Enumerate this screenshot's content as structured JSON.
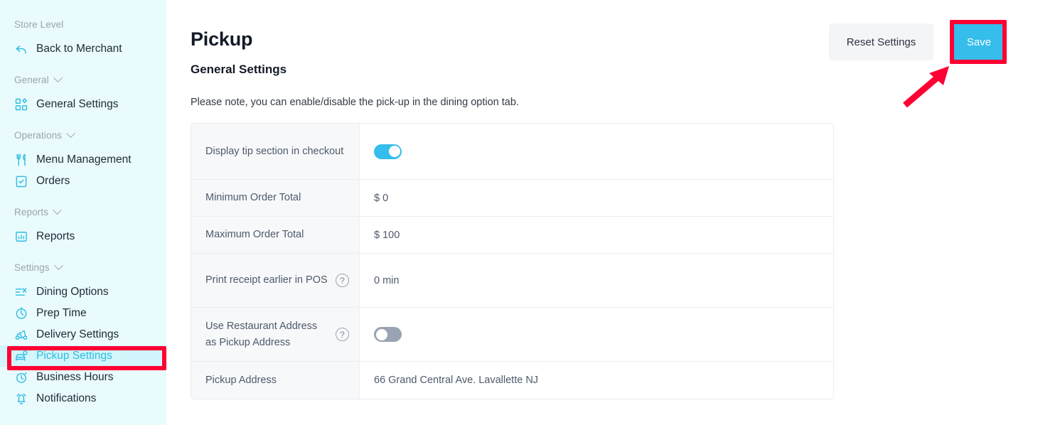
{
  "sidebar": {
    "groups": [
      {
        "label": "Store Level",
        "collapsible": false,
        "items": [
          {
            "label": "Back to Merchant",
            "icon": "back-arrow-icon",
            "active": false
          }
        ]
      },
      {
        "label": "General",
        "collapsible": true,
        "items": [
          {
            "label": "General Settings",
            "icon": "grid-blocks-icon",
            "active": false
          }
        ]
      },
      {
        "label": "Operations",
        "collapsible": true,
        "items": [
          {
            "label": "Menu Management",
            "icon": "fork-spoon-icon",
            "active": false
          },
          {
            "label": "Orders",
            "icon": "clipboard-check-icon",
            "active": false
          }
        ]
      },
      {
        "label": "Reports",
        "collapsible": true,
        "items": [
          {
            "label": "Reports",
            "icon": "bar-chart-icon",
            "active": false
          }
        ]
      },
      {
        "label": "Settings",
        "collapsible": true,
        "items": [
          {
            "label": "Dining Options",
            "icon": "sliders-icon",
            "active": false
          },
          {
            "label": "Prep Time",
            "icon": "clock-icon",
            "active": false
          },
          {
            "label": "Delivery Settings",
            "icon": "scooter-icon",
            "active": false
          },
          {
            "label": "Pickup Settings",
            "icon": "car-pickup-icon",
            "active": true
          },
          {
            "label": "Business Hours",
            "icon": "stopwatch-icon",
            "active": false
          },
          {
            "label": "Notifications",
            "icon": "bell-icon",
            "active": false
          }
        ]
      }
    ]
  },
  "header": {
    "page_title": "Pickup",
    "section_title": "General Settings",
    "note": "Please note, you can enable/disable the pick-up in the dining option tab.",
    "reset_label": "Reset Settings",
    "save_label": "Save"
  },
  "settings_rows": [
    {
      "label": "Display tip section in checkout",
      "has_help": false,
      "control": "toggle",
      "value": "on",
      "height": "h79"
    },
    {
      "label": "Minimum Order Total",
      "has_help": false,
      "control": "text",
      "value": "$ 0",
      "height": "h52"
    },
    {
      "label": "Maximum Order Total",
      "has_help": false,
      "control": "text",
      "value": "$ 100",
      "height": "h52"
    },
    {
      "label": "Print receipt earlier in POS",
      "has_help": true,
      "help_glyph": "?",
      "control": "text",
      "value": "0 min",
      "height": "h76"
    },
    {
      "label": "Use Restaurant Address as Pickup Address",
      "has_help": true,
      "help_glyph": "?",
      "control": "toggle",
      "value": "off",
      "height": "h76"
    },
    {
      "label": "Pickup Address",
      "has_help": false,
      "control": "text",
      "value": "66 Grand Central Ave. Lavallette NJ",
      "height": "h52"
    }
  ],
  "annotations": {
    "highlight_color": "#ff0033",
    "save_box": true,
    "sidebar_box_target": "Pickup Settings",
    "arrow_to": "Save"
  },
  "colors": {
    "accent": "#35bdeb",
    "sidebar_bg": "#e9fbfd",
    "sidebar_active_bg": "#d2f6fb",
    "toggle_off": "#99a3b2",
    "annotation_red": "#ff0033"
  }
}
